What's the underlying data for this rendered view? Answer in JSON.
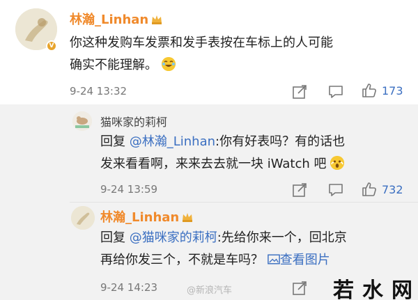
{
  "comment": {
    "author": "林瀚_Linhan",
    "text_line1": "你这种发购车发票和发手表按在车标上的人可能",
    "text_line2": "确实不能理解。",
    "time": "9-24 13:32",
    "likes": "173",
    "verified_badge": "V"
  },
  "replies": [
    {
      "author": "猫咪家的莉柯",
      "prefix": "回复",
      "mention": "@林瀚_Linhan",
      "text_line1": ":你有好表吗？有的话也",
      "text_line2": "发来看看啊，来来去去就一块 iWatch 吧",
      "time": "9-24 13:59",
      "likes": "732"
    },
    {
      "author": "林瀚_Linhan",
      "prefix": "回复",
      "mention": "@猫咪家的莉柯",
      "text_line1": ":先给你来一个，回北京",
      "text_line2": "再给你发三个，不就是车吗？",
      "link": "查看图片",
      "time": "9-24 14:23"
    }
  ],
  "watermarks": {
    "weibo": "@新浪汽车",
    "site": "若水网"
  },
  "icons": {
    "share": "share-icon",
    "comment": "comment-icon",
    "like": "like-icon",
    "image": "image-icon"
  },
  "colors": {
    "name_orange": "#f08a2c",
    "link_blue": "#3b6fc1"
  }
}
